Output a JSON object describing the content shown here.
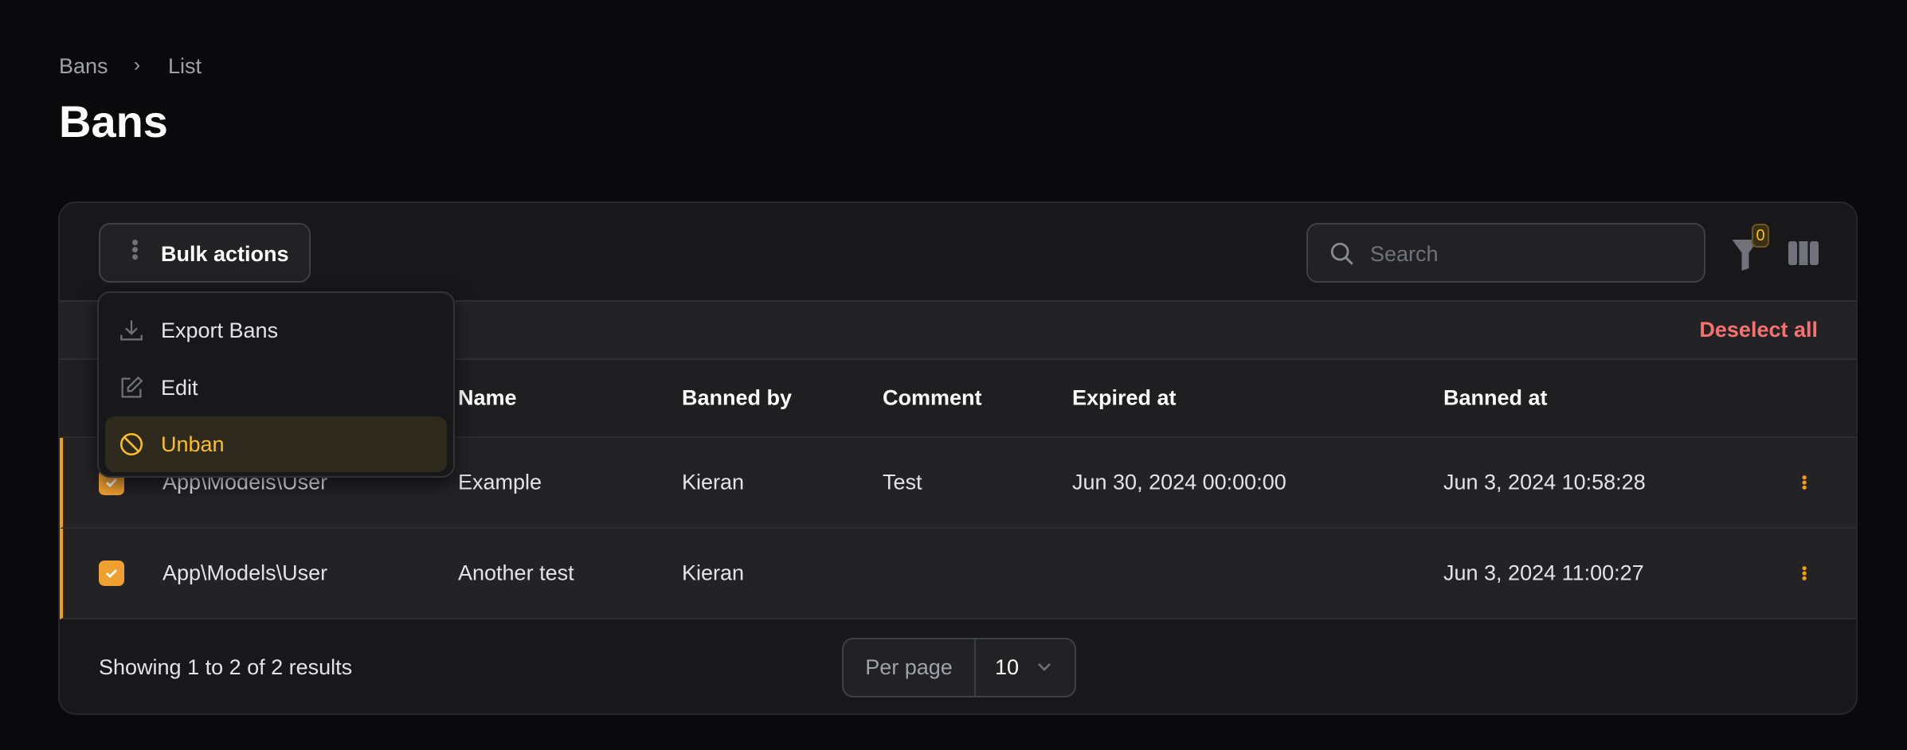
{
  "breadcrumb": {
    "items": [
      "Bans",
      "List"
    ]
  },
  "page_title": "Bans",
  "toolbar": {
    "bulk_actions": "Bulk actions",
    "search_placeholder": "Search",
    "filter_count": "0"
  },
  "bulk_menu": {
    "items": [
      {
        "label": "Export Bans",
        "icon": "download-icon"
      },
      {
        "label": "Edit",
        "icon": "pencil-square-icon"
      },
      {
        "label": "Unban",
        "icon": "no-symbol-icon"
      }
    ]
  },
  "selection": {
    "deselect_all": "Deselect all"
  },
  "table": {
    "headers": [
      "Name",
      "Banned by",
      "Comment",
      "Expired at",
      "Banned at"
    ],
    "rows": [
      {
        "type": "App\\Models\\User",
        "name": "Example",
        "banned_by": "Kieran",
        "comment": "Test",
        "expired_at": "Jun 30, 2024 00:00:00",
        "banned_at": "Jun 3, 2024 10:58:28",
        "checked": true
      },
      {
        "type": "App\\Models\\User",
        "name": "Another test",
        "banned_by": "Kieran",
        "comment": "",
        "expired_at": "",
        "banned_at": "Jun 3, 2024 11:00:27",
        "checked": true
      }
    ]
  },
  "footer": {
    "showing": "Showing 1 to 2 of 2 results",
    "per_page_label": "Per page",
    "per_page_value": "10"
  },
  "colors": {
    "accent": "#f59e0b",
    "danger": "#f87171",
    "background": "#0a0a0c"
  }
}
